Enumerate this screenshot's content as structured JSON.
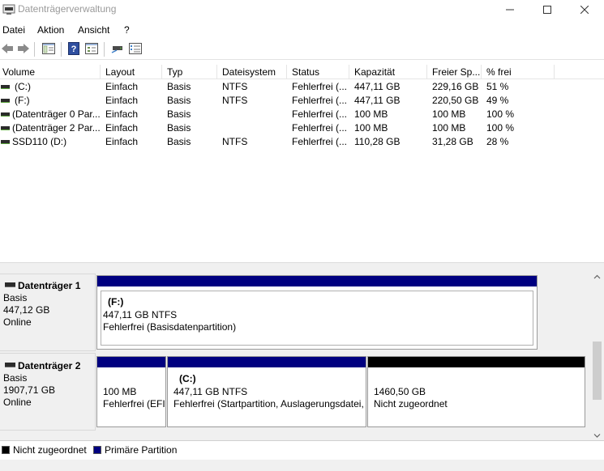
{
  "window": {
    "title": "Datenträgerverwaltung",
    "icons": {
      "app": "disk-management-icon",
      "minimize": "minimize-icon",
      "maximize": "maximize-icon",
      "close": "close-icon"
    }
  },
  "menu": {
    "items": [
      "Datei",
      "Aktion",
      "Ansicht",
      "?"
    ]
  },
  "toolbar": {
    "buttons": [
      "back-icon",
      "forward-icon",
      "console-tree-icon",
      "help-icon",
      "properties-icon",
      "connect-icon",
      "settings-list-icon"
    ]
  },
  "volume_list": {
    "columns": [
      "Volume",
      "Layout",
      "Typ",
      "Dateisystem",
      "Status",
      "Kapazität",
      "Freier Sp...",
      "% frei"
    ],
    "rows": [
      {
        "volume": "(C:)",
        "layout": "Einfach",
        "type": "Basis",
        "fs": "NTFS",
        "status": "Fehlerfrei (...",
        "capacity": "447,11 GB",
        "free": "229,16 GB",
        "pct": "51 %"
      },
      {
        "volume": "(F:)",
        "layout": "Einfach",
        "type": "Basis",
        "fs": "NTFS",
        "status": "Fehlerfrei (...",
        "capacity": "447,11 GB",
        "free": "220,50 GB",
        "pct": "49 %"
      },
      {
        "volume": "(Datenträger 0 Par...",
        "layout": "Einfach",
        "type": "Basis",
        "fs": "",
        "status": "Fehlerfrei (...",
        "capacity": "100 MB",
        "free": "100 MB",
        "pct": "100 %"
      },
      {
        "volume": "(Datenträger 2 Par...",
        "layout": "Einfach",
        "type": "Basis",
        "fs": "",
        "status": "Fehlerfrei (...",
        "capacity": "100 MB",
        "free": "100 MB",
        "pct": "100 %"
      },
      {
        "volume": "SSD110 (D:)",
        "layout": "Einfach",
        "type": "Basis",
        "fs": "NTFS",
        "status": "Fehlerfrei (...",
        "capacity": "110,28 GB",
        "free": "31,28 GB",
        "pct": "28 %"
      }
    ]
  },
  "disks": [
    {
      "name": "Datenträger 1",
      "type": "Basis",
      "size": "447,12 GB",
      "state": "Online",
      "partitions": [
        {
          "label": "(F:)",
          "size_fs": "447,11 GB NTFS",
          "status": "Fehlerfrei (Basisdatenpartition)",
          "kind": "primary"
        }
      ]
    },
    {
      "name": "Datenträger 2",
      "type": "Basis",
      "size": "1907,71 GB",
      "state": "Online",
      "partitions": [
        {
          "label": "",
          "size_fs": "100 MB",
          "status": "Fehlerfrei (EFI",
          "kind": "primary"
        },
        {
          "label": "(C:)",
          "size_fs": "447,11 GB NTFS",
          "status": "Fehlerfrei (Startpartition, Auslagerungsdatei,",
          "kind": "primary"
        },
        {
          "label": "",
          "size_fs": "1460,50 GB",
          "status": "Nicht zugeordnet",
          "kind": "unallocated"
        }
      ]
    }
  ],
  "legend": [
    {
      "label": "Nicht zugeordnet",
      "color": "#000000"
    },
    {
      "label": "Primäre Partition",
      "color": "#000080"
    }
  ],
  "colors": {
    "primary": "#000080",
    "unallocated": "#000000",
    "selection": "#ffffff"
  }
}
